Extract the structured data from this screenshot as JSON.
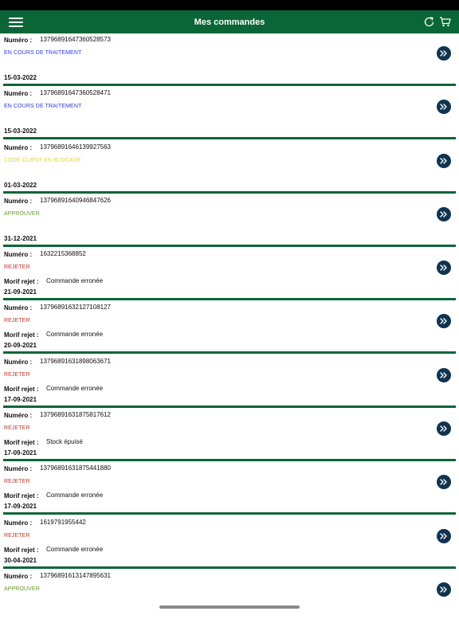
{
  "header": {
    "title": "Mes commandes"
  },
  "icons": {
    "menu": "hamburger-menu-icon",
    "refresh": "refresh-icon",
    "cart": "shopping-cart-icon",
    "go": "double-chevron-right-icon"
  },
  "colors": {
    "brand": "#0b6637",
    "button": "#11334f",
    "status_en_cours": "#2f3ddb",
    "status_code_client": "#d7dc22",
    "status_approuver": "#6a9b2a",
    "status_rejeter": "#c0392b"
  },
  "labels": {
    "numero": "Numéro :",
    "motif": "Morif rejet :"
  },
  "orders": [
    {
      "numero": "13796891647360528573",
      "status": "EN COURS DE TRAITEMENT",
      "status_color": "#2f3ddb",
      "motif": "",
      "date": "15-03-2022"
    },
    {
      "numero": "13796891647360528471",
      "status": "EN COURS DE TRAITEMENT",
      "status_color": "#2f3ddb",
      "motif": "",
      "date": "15-03-2022"
    },
    {
      "numero": "13796891646139927563",
      "status": "CODE CLIENT EN BLOCAGE",
      "status_color": "#d7dc22",
      "motif": "",
      "date": "01-03-2022"
    },
    {
      "numero": "13796891640946847626",
      "status": "APPROUVER",
      "status_color": "#6a9b2a",
      "motif": "",
      "date": "31-12-2021"
    },
    {
      "numero": "1632215368852",
      "status": "REJETER",
      "status_color": "#c0392b",
      "motif": "Commande erronée",
      "date": "21-09-2021"
    },
    {
      "numero": "13796891632127108127",
      "status": "REJETER",
      "status_color": "#c0392b",
      "motif": "Commande erronée",
      "date": "20-09-2021"
    },
    {
      "numero": "13796891631898063671",
      "status": "REJETER",
      "status_color": "#c0392b",
      "motif": "Commande erronée",
      "date": "17-09-2021"
    },
    {
      "numero": "13796891631875817612",
      "status": "REJETER",
      "status_color": "#c0392b",
      "motif": "Stock épuisé",
      "date": "17-09-2021"
    },
    {
      "numero": "13796891631875441880",
      "status": "REJETER",
      "status_color": "#c0392b",
      "motif": "Commande erronée",
      "date": "17-09-2021"
    },
    {
      "numero": "1619791955442",
      "status": "REJETER",
      "status_color": "#c0392b",
      "motif": "Commande erronée",
      "date": "30-04-2021"
    },
    {
      "numero": "13796891613147895631",
      "status": "APPROUVER",
      "status_color": "#6a9b2a",
      "motif": "",
      "date": ""
    }
  ]
}
